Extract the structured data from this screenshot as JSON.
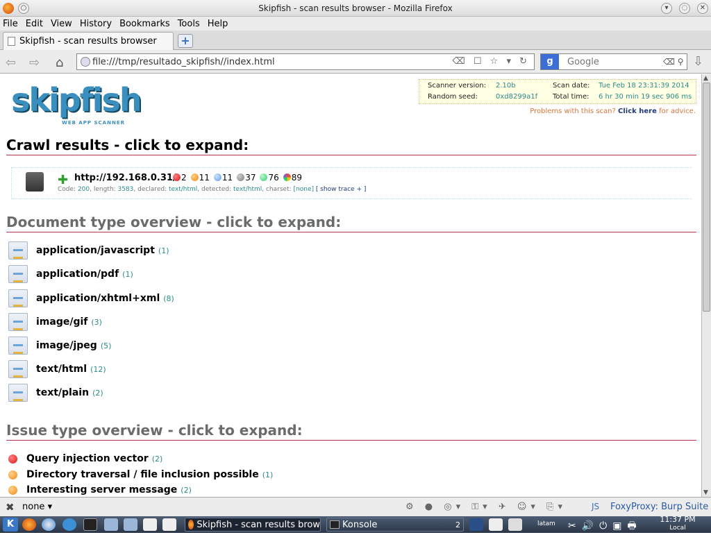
{
  "window": {
    "title": "Skipfish - scan results browser - Mozilla Firefox"
  },
  "menu": [
    "File",
    "Edit",
    "View",
    "History",
    "Bookmarks",
    "Tools",
    "Help"
  ],
  "tab": {
    "label": "Skipfish - scan results browser",
    "new_tab": "+"
  },
  "nav": {
    "url": "file:///tmp/resultado_skipfish//index.html",
    "search_placeholder": "Google"
  },
  "page": {
    "logo_text": "skipfish",
    "logo_sub": "WEB APP SCANNER",
    "info": {
      "scanner_version_label": "Scanner version:",
      "scanner_version": "2.10b",
      "random_seed_label": "Random seed:",
      "random_seed": "0xd8299a1f",
      "scan_date_label": "Scan date:",
      "scan_date": "Tue Feb 18 23:31:39 2014",
      "total_time_label": "Total time:",
      "total_time": "6 hr 30 min 19 sec 906 ms"
    },
    "advice": {
      "prefix": "Problems with this scan?",
      "link": "Click here",
      "suffix": "for advice."
    },
    "crawl_heading": "Crawl results - click to expand:",
    "crawl": {
      "url": "http://192.168.0.31/",
      "badges": [
        {
          "count": "2",
          "color": "#d61a1a"
        },
        {
          "count": "11",
          "color": "#f08a17"
        },
        {
          "count": "11",
          "color": "#5a9be0"
        },
        {
          "count": "37",
          "color": "#7a7a7a"
        },
        {
          "count": "76",
          "color": "#2fcf6a"
        },
        {
          "count": "89",
          "color": "#9b59b6"
        }
      ],
      "meta": {
        "code_label": "Code:",
        "code": "200",
        "length_label": ", length:",
        "length": "3583",
        "declared_label": ", declared:",
        "declared": "text/html",
        "detected_label": ", detected:",
        "detected": "text/html",
        "charset_label": ", charset:",
        "charset": "[none]",
        "trace": "[ show trace + ]"
      }
    },
    "doctype_heading": "Document type overview - click to expand:",
    "doctypes": [
      {
        "name": "application/javascript",
        "count": "(1)"
      },
      {
        "name": "application/pdf",
        "count": "(1)"
      },
      {
        "name": "application/xhtml+xml",
        "count": "(8)"
      },
      {
        "name": "image/gif",
        "count": "(3)"
      },
      {
        "name": "image/jpeg",
        "count": "(5)"
      },
      {
        "name": "text/html",
        "count": "(12)"
      },
      {
        "name": "text/plain",
        "count": "(2)"
      }
    ],
    "issue_heading": "Issue type overview - click to expand:",
    "issues": [
      {
        "name": "Query injection vector",
        "count": "(2)",
        "color": "#d61a1a"
      },
      {
        "name": "Directory traversal / file inclusion possible",
        "count": "(1)",
        "color": "#f08a17"
      },
      {
        "name": "Interesting server message",
        "count": "(2)",
        "color": "#f08a17"
      }
    ]
  },
  "status": {
    "left": "none",
    "js": "JS",
    "proxy": "FoxyProxy: Burp Suite"
  },
  "taskbar": {
    "tasks": [
      "Skipfish - scan results brow",
      "Konsole"
    ],
    "desktop": "2",
    "lang": "latam",
    "time": "11:37 PM",
    "tz": "Local"
  }
}
